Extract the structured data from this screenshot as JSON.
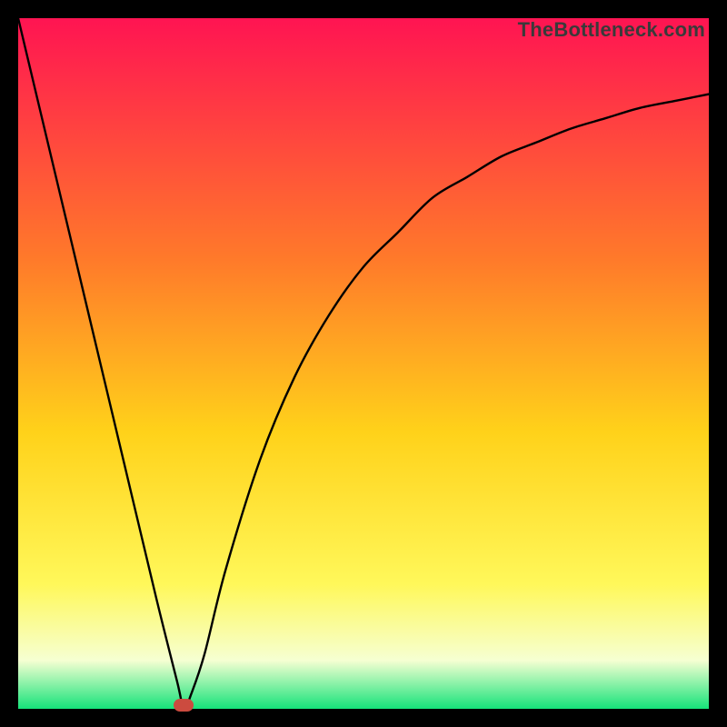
{
  "watermark": "TheBottleneck.com",
  "colors": {
    "top": "#ff1452",
    "mid_upper": "#ff7a2a",
    "mid": "#ffd21a",
    "mid_lower": "#fff85a",
    "pale": "#f6ffd2",
    "bottom": "#16e37a",
    "curve": "#000000",
    "marker": "#cc4b3f",
    "frame_bg": "#000000"
  },
  "chart_data": {
    "type": "line",
    "title": "",
    "xlabel": "",
    "ylabel": "",
    "xlim": [
      0,
      100
    ],
    "ylim": [
      0,
      100
    ],
    "bottleneck_x": 24,
    "series": [
      {
        "name": "bottleneck-curve",
        "x": [
          0,
          5,
          10,
          15,
          20,
          23,
          24,
          25,
          27,
          30,
          35,
          40,
          45,
          50,
          55,
          60,
          65,
          70,
          75,
          80,
          85,
          90,
          95,
          100
        ],
        "values": [
          100,
          79,
          58,
          37,
          16,
          4,
          0,
          2,
          8,
          20,
          36,
          48,
          57,
          64,
          69,
          74,
          77,
          80,
          82,
          84,
          85.5,
          87,
          88,
          89
        ]
      }
    ],
    "annotations": [],
    "legend": [],
    "grid": false
  }
}
